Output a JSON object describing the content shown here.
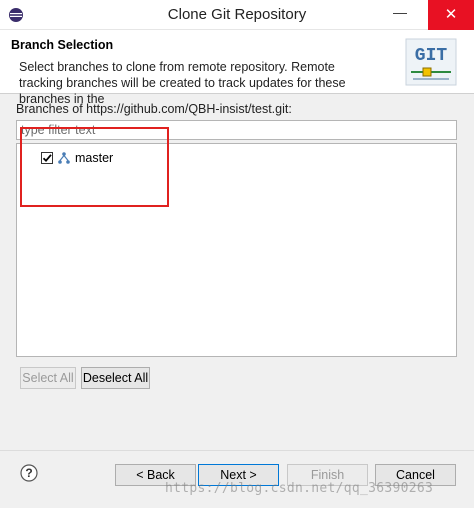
{
  "window": {
    "title": "Clone Git Repository",
    "minimize_glyph": "—",
    "close_glyph": "✕"
  },
  "header": {
    "title": "Branch Selection",
    "description": "Select branches to clone from remote repository. Remote tracking branches will be created to track updates for these branches in the",
    "logo_text": "GIT"
  },
  "branches": {
    "label": "Branches of https://github.com/QBH-insist/test.git:",
    "filter_placeholder": "type filter text",
    "items": [
      {
        "label": "master",
        "checked": true
      }
    ]
  },
  "buttons": {
    "select_all": "Select All",
    "deselect_all": "Deselect All",
    "back": "< Back",
    "next": "Next >",
    "finish": "Finish",
    "cancel": "Cancel"
  },
  "watermark": "https://blog.csdn.net/qq_36390263",
  "colors": {
    "highlight": "#e0211f",
    "close_button": "#e81123",
    "primary_border": "#0078d7"
  }
}
